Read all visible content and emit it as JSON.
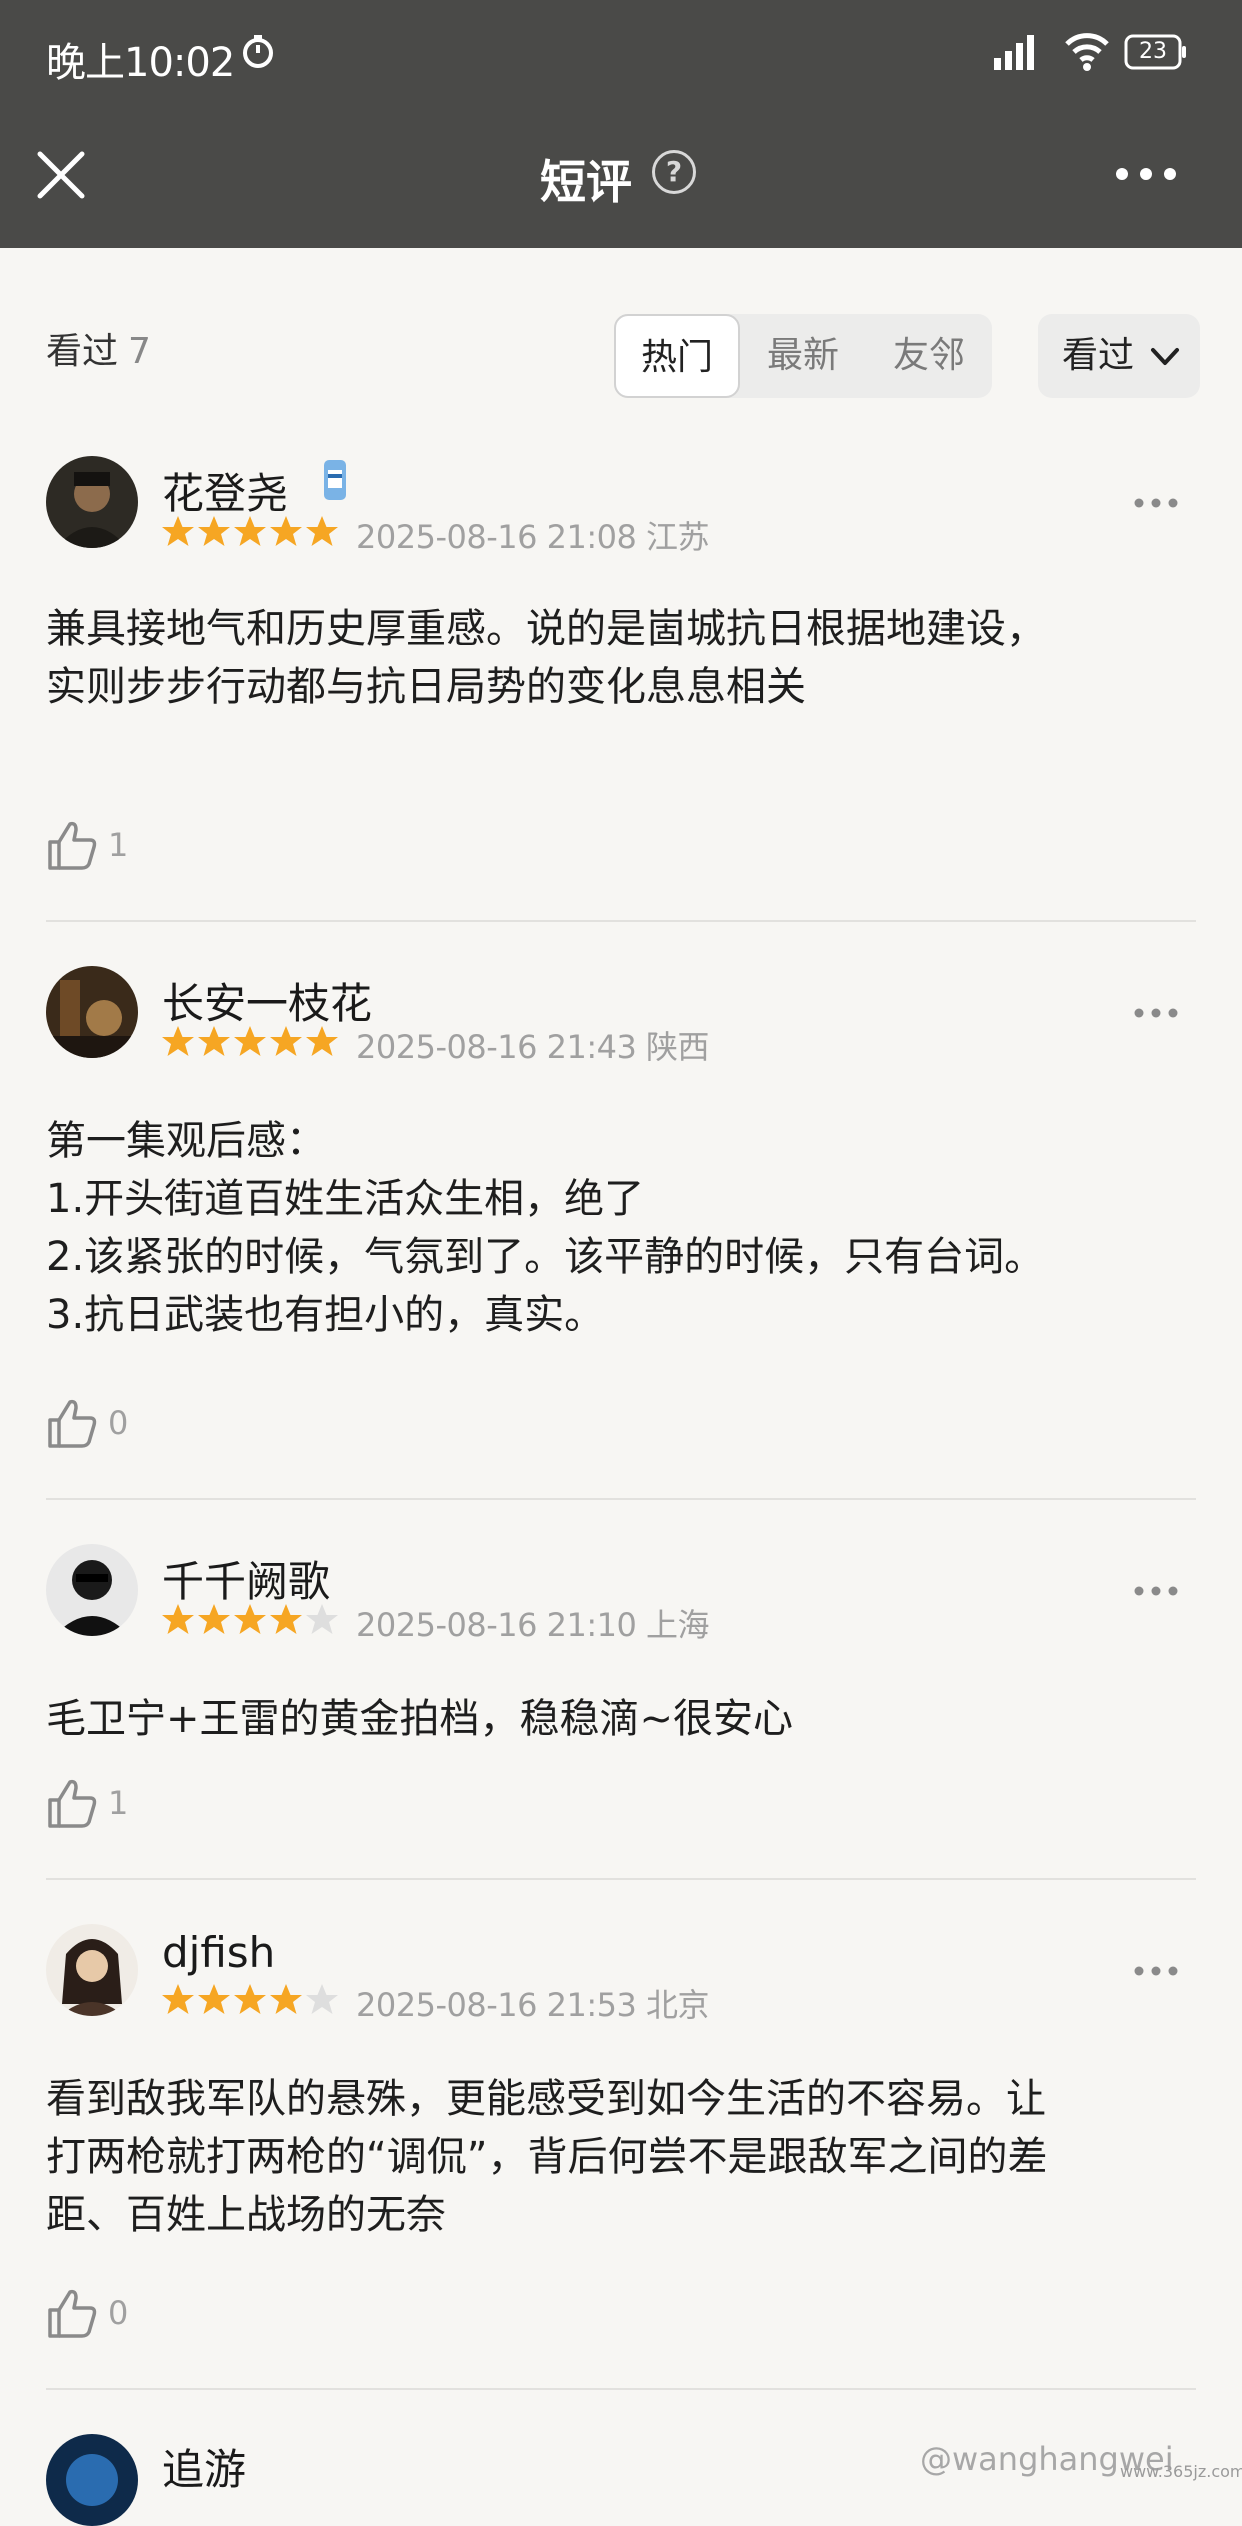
{
  "status": {
    "time": "晚上10:02",
    "battery": "23"
  },
  "header": {
    "title": "短评",
    "help_glyph": "?"
  },
  "filter": {
    "watched_label": "看过",
    "watched_count": "7",
    "tabs": [
      {
        "label": "热门",
        "active": true
      },
      {
        "label": "最新",
        "active": false
      },
      {
        "label": "友邻",
        "active": false
      }
    ],
    "dropdown_label": "看过"
  },
  "reviews": [
    {
      "username": "花登尧",
      "has_badge": true,
      "stars": 5,
      "time": "2025-08-16 21:08",
      "location": "江苏",
      "text": "兼具接地气和历史厚重感。说的是崮城抗日根据地建设，\n实则步步行动都与抗日局势的变化息息相关",
      "likes": "1"
    },
    {
      "username": "长安一枝花",
      "has_badge": false,
      "stars": 5,
      "time": "2025-08-16 21:43",
      "location": "陕西",
      "text": "第一集观后感：\n1.开头街道百姓生活众生相，绝了\n2.该紧张的时候，气氛到了。该平静的时候，只有台词。\n3.抗日武装也有担小的，真实。",
      "likes": "0"
    },
    {
      "username": "千千阙歌",
      "has_badge": false,
      "stars": 4,
      "time": "2025-08-16 21:10",
      "location": "上海",
      "text": "毛卫宁+王雷的黄金拍档，稳稳滴~很安心",
      "likes": "1"
    },
    {
      "username": "djfish",
      "has_badge": false,
      "stars": 4,
      "time": "2025-08-16 21:53",
      "location": "北京",
      "text": "看到敌我军队的悬殊，更能感受到如今生活的不容易。让\n打两枪就打两枪的“调侃”，背后何尝不是跟敌军之间的差\n距、百姓上战场的无奈",
      "likes": "0"
    },
    {
      "username": "追游",
      "has_badge": false,
      "stars": 0,
      "time": "",
      "location": "",
      "text": "",
      "likes": ""
    }
  ],
  "watermark": "@wanghangwei",
  "watermark_sub": "www.365jz.com",
  "colors": {
    "header_bg": "#4a4a48",
    "star": "#f6a623",
    "star_empty": "#dedede",
    "page_bg": "#f7f6f3"
  }
}
